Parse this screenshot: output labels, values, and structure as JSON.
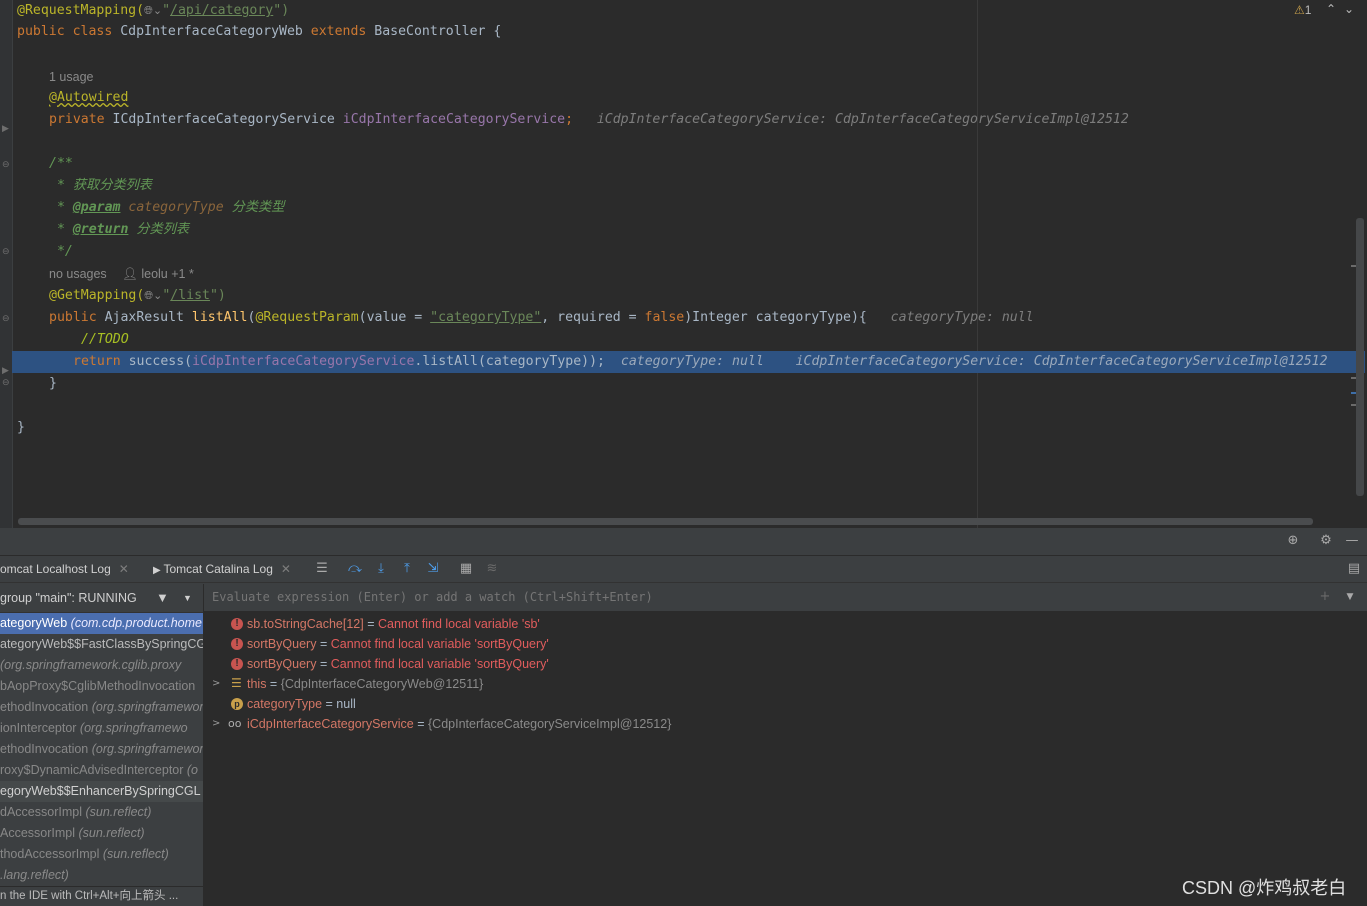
{
  "editor": {
    "line1": {
      "annotation": "@RequestMapping(",
      "url": "/api/category",
      "close": "\")"
    },
    "line2": {
      "kw1": "public class",
      "name": " CdpInterfaceCategoryWeb ",
      "kw2": "extends",
      "rest": " BaseController {"
    },
    "usage_hint": "1 usage",
    "autowired": "@Autowired",
    "field_line": {
      "kw": "private",
      "type": " ICdpInterfaceCategoryService ",
      "name": "iCdpInterfaceCategoryService",
      "semi": ";",
      "inline": "iCdpInterfaceCategoryService: CdpInterfaceCategoryServiceImpl@12512"
    },
    "doc_open": "/**",
    "doc_desc": " * 获取分类列表",
    "doc_param": {
      "prefix": " * ",
      "tag": "@param",
      "name": " categoryType",
      "desc": " 分类类型"
    },
    "doc_return": {
      "prefix": " * ",
      "tag": "@return",
      "desc": " 分类列表"
    },
    "doc_close": " */",
    "no_usages_hint": "no usages",
    "author_hint": "leolu +1 *",
    "getmapping": {
      "annotation": "@GetMapping(",
      "url": "/list",
      "close": "\")"
    },
    "method_line": {
      "kw": "public",
      "type": " AjaxResult ",
      "name": "listAll",
      "open": "(",
      "ann": "@RequestParam",
      "p1": "(value = ",
      "str": "\"categoryType\"",
      "p2": ", required = ",
      "false_kw": "false",
      "p3": ")Integer categoryType){",
      "inline": "categoryType: null"
    },
    "todo": "//TODO",
    "return_line": {
      "kw": "return",
      "call": " success(",
      "field": "iCdpInterfaceCategoryService",
      "rest": ".listAll(categoryType));",
      "inline1": "categoryType: null",
      "inline2": "iCdpInterfaceCategoryService: CdpInterfaceCategoryServiceImpl@12512"
    },
    "close_brace_method": "}",
    "close_brace_class": "}",
    "warnings": "1"
  },
  "debug": {
    "tabs": [
      {
        "label": "omcat Localhost Log"
      },
      {
        "label": "Tomcat Catalina Log"
      }
    ],
    "thread": "group \"main\": RUNNING",
    "frames": [
      {
        "name": "ategoryWeb ",
        "pkg": "(com.cdp.product.home",
        "style": "sel"
      },
      {
        "name": "ategoryWeb$$FastClassBySpringCG",
        "pkg": "",
        "style": "normal"
      },
      {
        "name": " ",
        "pkg": "(org.springframework.cglib.proxy",
        "style": "lib"
      },
      {
        "name": "bAopProxy$CglibMethodInvocation",
        "pkg": "",
        "style": "lib"
      },
      {
        "name": "ethodInvocation ",
        "pkg": "(org.springframework",
        "style": "lib"
      },
      {
        "name": "ionInterceptor ",
        "pkg": "(org.springframewo",
        "style": "lib"
      },
      {
        "name": "ethodInvocation ",
        "pkg": "(org.springframework",
        "style": "lib"
      },
      {
        "name": "roxy$DynamicAdvisedInterceptor ",
        "pkg": "(o",
        "style": "lib"
      },
      {
        "name": "egoryWeb$$EnhancerBySpringCGL",
        "pkg": "",
        "style": "hl"
      },
      {
        "name": "dAccessorImpl ",
        "pkg": "(sun.reflect)",
        "style": "lib"
      },
      {
        "name": "AccessorImpl ",
        "pkg": "(sun.reflect)",
        "style": "lib"
      },
      {
        "name": "thodAccessorImpl ",
        "pkg": "(sun.reflect)",
        "style": "lib"
      },
      {
        "name": "",
        "pkg": ".lang.reflect)",
        "style": "lib"
      }
    ],
    "frame_hint": "n the IDE with Ctrl+Alt+向上箭头 ...",
    "eval_placeholder": "Evaluate expression (Enter) or add a watch (Ctrl+Shift+Enter)",
    "variables": [
      {
        "kind": "error",
        "name": "sb.toStringCache[12]",
        "eq": " = ",
        "value": "Cannot find local variable 'sb'"
      },
      {
        "kind": "error",
        "name": "sortByQuery",
        "eq": " = ",
        "value": "Cannot find local variable 'sortByQuery'"
      },
      {
        "kind": "error",
        "name": "sortByQuery",
        "eq": " = ",
        "value": "Cannot find local variable 'sortByQuery'"
      },
      {
        "kind": "this",
        "name": "this",
        "eq": " = ",
        "value": "{CdpInterfaceCategoryWeb@12511}"
      },
      {
        "kind": "param",
        "name": "categoryType",
        "eq": " = ",
        "value": "null"
      },
      {
        "kind": "field",
        "name": "iCdpInterfaceCategoryService",
        "eq": " = ",
        "value": "{CdpInterfaceCategoryServiceImpl@12512}"
      }
    ]
  },
  "watermark": "CSDN @炸鸡叔老白",
  "colors": {
    "exec_line": "#2d5282",
    "selected_frame": "#4b6eaf",
    "error": "#e25d5d"
  }
}
